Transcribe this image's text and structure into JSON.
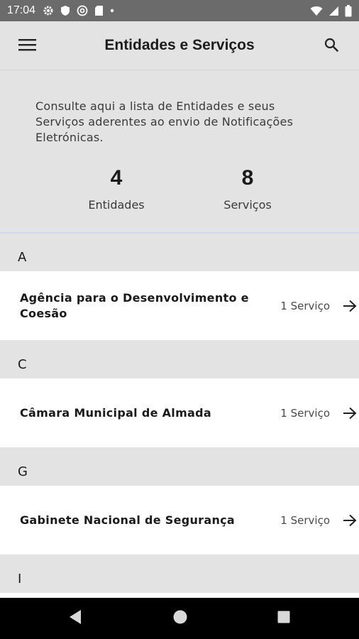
{
  "status_bar": {
    "time": "17:04",
    "left_icons": [
      "settings-gear-icon",
      "shield-icon",
      "at-sign-icon",
      "sd-card-icon",
      "dot-icon"
    ],
    "right_icons": [
      "wifi-icon",
      "signal-icon",
      "battery-icon"
    ]
  },
  "app_bar": {
    "title": "Entidades e Serviços",
    "menu_icon": "menu-icon",
    "search_icon": "search-icon"
  },
  "intro": {
    "description": "Consulte aqui a lista de Entidades e seus Serviços aderentes ao envio de Notificações Eletrónicas.",
    "stats": {
      "entities_value": "4",
      "entities_label": "Entidades",
      "services_value": "8",
      "services_label": "Serviços"
    }
  },
  "sections": [
    {
      "letter": "A",
      "items": [
        {
          "name": "Agência para o Desenvolvimento e Coesão",
          "count": "1 Serviço"
        }
      ]
    },
    {
      "letter": "C",
      "items": [
        {
          "name": "Câmara Municipal de Almada",
          "count": "1 Serviço"
        }
      ]
    },
    {
      "letter": "G",
      "items": [
        {
          "name": "Gabinete Nacional de Segurança",
          "count": "1 Serviço"
        }
      ]
    },
    {
      "letter": "I",
      "items": []
    }
  ],
  "nav_bar": {
    "icons": [
      "back-triangle-icon",
      "home-circle-icon",
      "recents-square-icon"
    ]
  },
  "colors": {
    "background": "#e3e3e3",
    "status_bar": "#6b6b6b",
    "list_item": "#ffffff",
    "nav_bar": "#000000"
  }
}
